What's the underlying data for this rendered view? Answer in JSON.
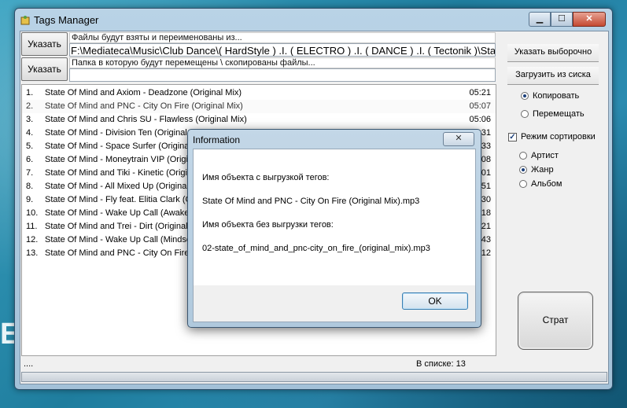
{
  "window": {
    "title": "Tags Manager",
    "minimize_label": "▁",
    "maximize_label": "☐",
    "close_label": "✕"
  },
  "source": {
    "button_label": "Указать",
    "hint": "Файлы будут взяты и переименованы из...",
    "path": "F:\\Mediateca\\Music\\Club Dance\\( HardStyle ) .I. ( ELECTRO ) .I. ( DANCE ) .I. ( Tectonik )\\Stat"
  },
  "destination": {
    "button_label": "Указать",
    "hint": "Папка в которую будут перемещены \\ скопированы файлы..."
  },
  "tracks": [
    {
      "num": "1.",
      "name": "State Of Mind and Axiom - Deadzone (Original Mix)",
      "duration": "05:21"
    },
    {
      "num": "2.",
      "name": "State Of Mind and PNC - City On Fire (Original Mix)",
      "duration": "05:07"
    },
    {
      "num": "3.",
      "name": "State Of Mind and Chris SU - Flawless (Original Mix)",
      "duration": "05:06"
    },
    {
      "num": "4.",
      "name": "State Of Mind - Division Ten (Original Mix)",
      "duration": "05:31"
    },
    {
      "num": "5.",
      "name": "State Of Mind - Space Surfer (Original Mix)",
      "duration": "05:33"
    },
    {
      "num": "6.",
      "name": "State Of Mind - Moneytrain VIP (Original Mix)",
      "duration": "05:08"
    },
    {
      "num": "7.",
      "name": "State Of Mind and Tiki - Kinetic (Original Mix)",
      "duration": "05:01"
    },
    {
      "num": "8.",
      "name": "State Of Mind - All Mixed Up (Original Mix)",
      "duration": "05:51"
    },
    {
      "num": "9.",
      "name": "State Of Mind - Fly feat. Elitia Clark (Original Mix)",
      "duration": "05:30"
    },
    {
      "num": "10.",
      "name": "State Of Mind - Wake Up Call (Awakening Mix)",
      "duration": "05:18"
    },
    {
      "num": "11.",
      "name": "State Of Mind and Trei - Dirt (Original Mix)",
      "duration": "05:21"
    },
    {
      "num": "12.",
      "name": "State Of Mind - Wake Up Call (Mindscape Mix)",
      "duration": "05:43"
    },
    {
      "num": "13.",
      "name": "State Of Mind and PNC - City On Fire (Sub Focus Mix)",
      "duration": "05:12"
    }
  ],
  "status": {
    "left": "....",
    "count_label": "В списке: 13"
  },
  "right_panel": {
    "select_button": "Указать выборочно",
    "load_button": "Загрузить из сиска",
    "copy_radio": "Копировать",
    "move_radio": "Перемещать",
    "sort_checkbox": "Режим сортировки",
    "artist_radio": "Артист",
    "genre_radio": "Жанр",
    "album_radio": "Альбом",
    "start_button": "Страт"
  },
  "dialog": {
    "title": "Information",
    "close_label": "✕",
    "label_with_tags": "Имя объекта с выгрузкой тегов:",
    "value_with_tags": "State Of Mind and PNC - City On Fire (Original Mix).mp3",
    "label_without_tags": "Имя объекта без выгрузки тегов:",
    "value_without_tags": "02-state_of_mind_and_pnc-city_on_fire_(original_mix).mp3",
    "ok_label": "OK"
  },
  "desktop": {
    "edge_letter": "E"
  },
  "colors": {
    "desktop": "#2f8fae",
    "window_frame": "#b9d3e6",
    "close_button": "#c44a32",
    "ok_border": "#3c7fb1"
  }
}
